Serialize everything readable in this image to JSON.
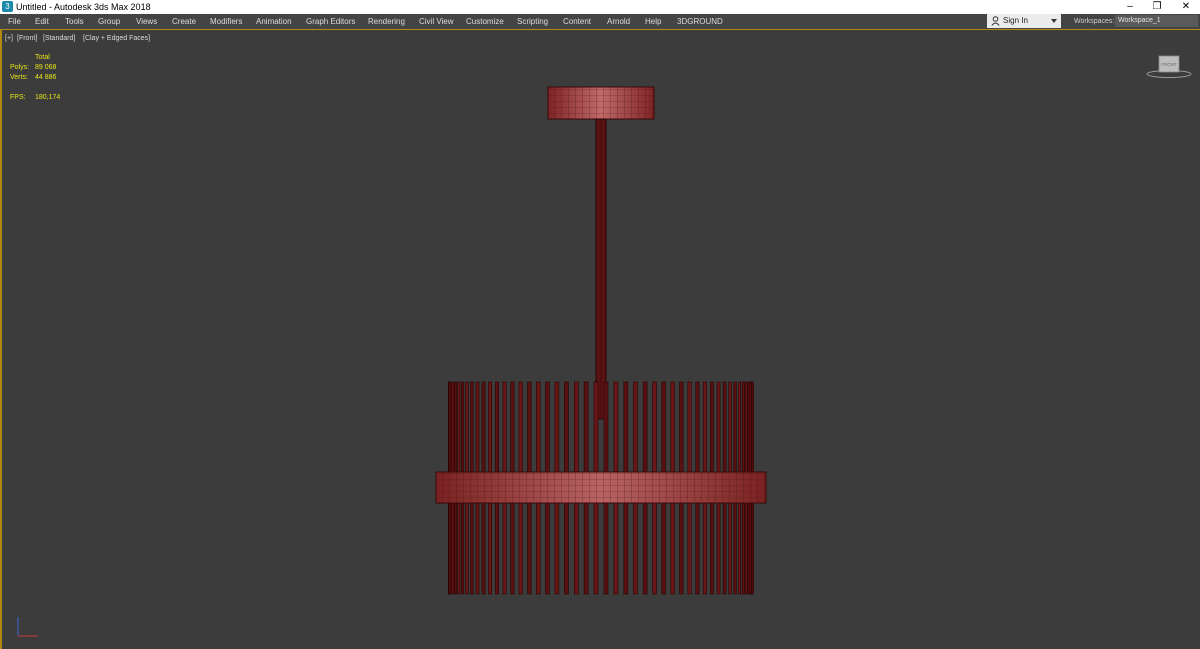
{
  "window": {
    "title": "Untitled - Autodesk 3ds Max 2018",
    "app_icon": "3",
    "minimize": "–",
    "restore": "❐",
    "close": "✕"
  },
  "menu": [
    {
      "label": "File"
    },
    {
      "label": "Edit"
    },
    {
      "label": "Tools"
    },
    {
      "label": "Group"
    },
    {
      "label": "Views"
    },
    {
      "label": "Create"
    },
    {
      "label": "Modifiers"
    },
    {
      "label": "Animation"
    },
    {
      "label": "Graph Editors"
    },
    {
      "label": "Rendering"
    },
    {
      "label": "Civil View"
    },
    {
      "label": "Customize"
    },
    {
      "label": "Scripting"
    },
    {
      "label": "Content"
    },
    {
      "label": "Arnold"
    },
    {
      "label": "Help"
    },
    {
      "label": "3DGROUND"
    }
  ],
  "signin": {
    "label": "Sign In",
    "icon": "user-icon"
  },
  "workspaces": {
    "label": "Workspaces:",
    "value": "Workspace_1"
  },
  "viewport": {
    "labels": [
      "[+]",
      "[Front]",
      "[Standard]",
      "[Clay + Edged Faces]"
    ],
    "stats": {
      "total_label": "Total",
      "polys_label": "Polys:",
      "polys_value": "89 068",
      "verts_label": "Verts:",
      "verts_value": "44 886",
      "fps_label": "FPS:",
      "fps_value": "180,174"
    },
    "viewcube_face": "FRONT"
  },
  "colors": {
    "accent": "#b08a10",
    "stats_text": "#e5e518",
    "model_fill": "#7a2020",
    "model_highlight": "#b85858",
    "viewport_bg": "#3c3c3c"
  }
}
